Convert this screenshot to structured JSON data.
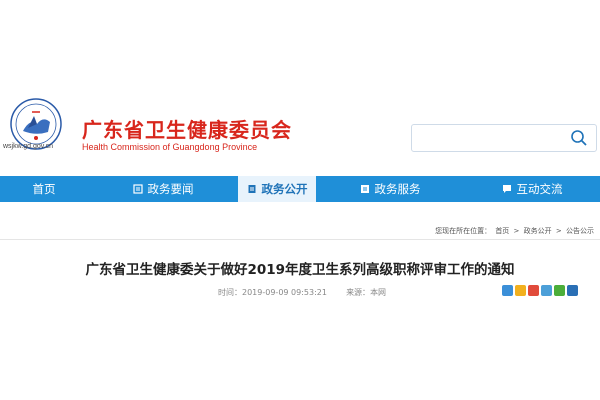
{
  "header": {
    "domain": "wsjkw.gd.gov.cn",
    "title_cn": "广东省卫生健康委员会",
    "title_en": "Health Commission of Guangdong Province"
  },
  "search": {
    "placeholder": ""
  },
  "nav": {
    "items": [
      {
        "label": "首页"
      },
      {
        "label": "政务要闻"
      },
      {
        "label": "政务公开"
      },
      {
        "label": "政务服务"
      },
      {
        "label": "互动交流"
      }
    ]
  },
  "breadcrumb": {
    "prefix": "您现在所在位置：",
    "items": [
      "首页",
      "政务公开",
      "公告公示"
    ],
    "separator": ">"
  },
  "article": {
    "title": "广东省卫生健康委关于做好2019年度卫生系列高级职称评审工作的通知",
    "time_label": "时间：",
    "time_value": "2019-09-09 09:53:21",
    "source_label": "来源：",
    "source_value": "本网"
  },
  "share_buttons": [
    {
      "icon": "share-more-icon",
      "color": "#3b8fd8"
    },
    {
      "icon": "share-qzone-icon",
      "color": "#f2b01e"
    },
    {
      "icon": "share-weibo-icon",
      "color": "#e14b3b"
    },
    {
      "icon": "share-tencent-weibo-icon",
      "color": "#4c9fd8"
    },
    {
      "icon": "share-wechat-icon",
      "color": "#4cae3a"
    },
    {
      "icon": "share-renren-icon",
      "color": "#2a6fb5"
    }
  ],
  "colors": {
    "brand_red": "#d8261c",
    "nav_blue": "#1f8fd8",
    "nav_active_bg": "#e8f3fc"
  }
}
